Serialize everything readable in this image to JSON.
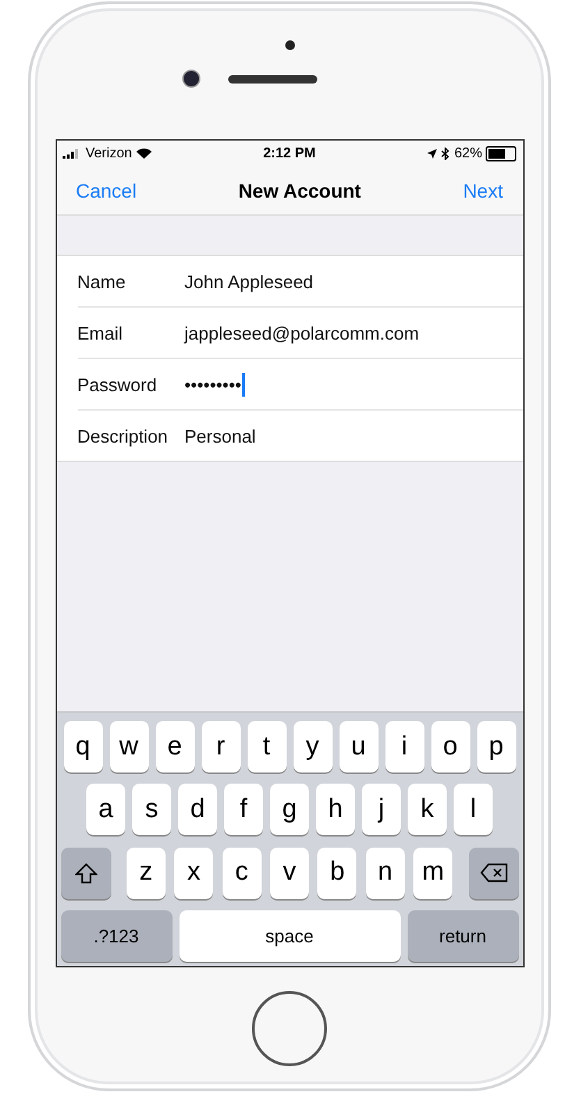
{
  "status_bar": {
    "carrier": "Verizon",
    "time": "2:12 PM",
    "battery": "62%"
  },
  "nav": {
    "cancel": "Cancel",
    "title": "New Account",
    "next": "Next"
  },
  "fields": [
    {
      "label": "Name",
      "value": "John Appleseed",
      "focused": false
    },
    {
      "label": "Email",
      "value": "jappleseed@polarcomm.com",
      "focused": false
    },
    {
      "label": "Password",
      "value": "•••••••••",
      "focused": true
    },
    {
      "label": "Description",
      "value": "Personal",
      "focused": false
    }
  ],
  "keyboard": {
    "rows": [
      {
        "keys": [
          {
            "kind": "letter",
            "label": "q"
          },
          {
            "kind": "letter",
            "label": "w"
          },
          {
            "kind": "letter",
            "label": "e"
          },
          {
            "kind": "letter",
            "label": "r"
          },
          {
            "kind": "letter",
            "label": "t"
          },
          {
            "kind": "letter",
            "label": "y"
          },
          {
            "kind": "letter",
            "label": "u"
          },
          {
            "kind": "letter",
            "label": "i"
          },
          {
            "kind": "letter",
            "label": "o"
          },
          {
            "kind": "letter",
            "label": "p"
          }
        ]
      },
      {
        "keys": [
          {
            "kind": "letter",
            "label": "a"
          },
          {
            "kind": "letter",
            "label": "s"
          },
          {
            "kind": "letter",
            "label": "d"
          },
          {
            "kind": "letter",
            "label": "f"
          },
          {
            "kind": "letter",
            "label": "g"
          },
          {
            "kind": "letter",
            "label": "h"
          },
          {
            "kind": "letter",
            "label": "j"
          },
          {
            "kind": "letter",
            "label": "k"
          },
          {
            "kind": "letter",
            "label": "l"
          }
        ]
      },
      {
        "keys": [
          {
            "kind": "shift"
          },
          {
            "kind": "letter",
            "label": "z"
          },
          {
            "kind": "letter",
            "label": "x"
          },
          {
            "kind": "letter",
            "label": "c"
          },
          {
            "kind": "letter",
            "label": "v"
          },
          {
            "kind": "letter",
            "label": "b"
          },
          {
            "kind": "letter",
            "label": "n"
          },
          {
            "kind": "letter",
            "label": "m"
          },
          {
            "kind": "delete"
          }
        ]
      },
      {
        "keys": [
          {
            "kind": "mode",
            "label": ".?123"
          },
          {
            "kind": "space",
            "label": "space"
          },
          {
            "kind": "return",
            "label": "return"
          }
        ]
      }
    ]
  }
}
